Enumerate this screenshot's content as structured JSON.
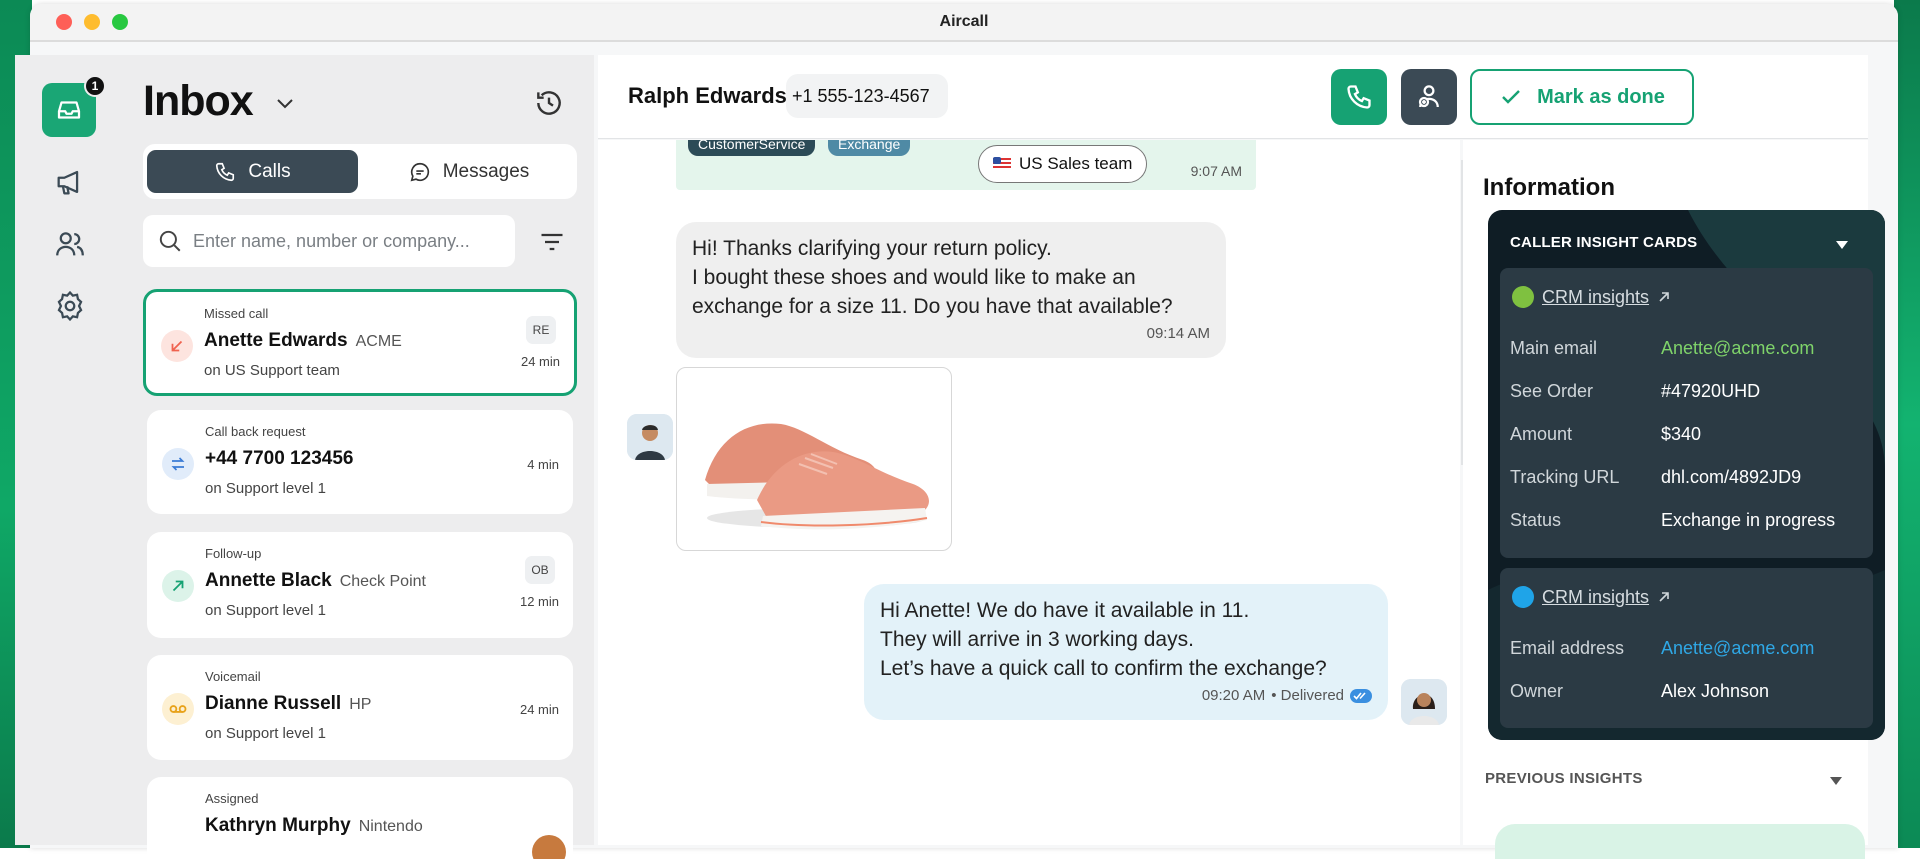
{
  "app": {
    "title": "Aircall"
  },
  "rail": {
    "badge": "1"
  },
  "inbox": {
    "title": "Inbox",
    "tabs": [
      {
        "label": "Calls"
      },
      {
        "label": "Messages"
      }
    ],
    "search_placeholder": "Enter name, number or company...",
    "items": [
      {
        "kind": "Missed call",
        "name": "Anette Edwards",
        "company": "ACME",
        "sub": "on  US Support team",
        "time": "24 min",
        "initials": "RE",
        "icon": "missed-call-icon",
        "color": "#f0624f"
      },
      {
        "kind": "Call back request",
        "name": "+44 7700 123456",
        "company": "",
        "sub": "on  Support level 1",
        "time": "4 min",
        "initials": "",
        "icon": "callback-icon",
        "color": "#3a7bd5"
      },
      {
        "kind": "Follow-up",
        "name": "Annette Black",
        "company": "Check Point",
        "sub": "on  Support level 1",
        "time": "12 min",
        "initials": "OB",
        "icon": "outgoing-call-icon",
        "color": "#16a273"
      },
      {
        "kind": "Voicemail",
        "name": "Dianne Russell",
        "company": "HP",
        "sub": "on  Support level 1",
        "time": "24 min",
        "initials": "",
        "icon": "voicemail-icon",
        "color": "#e8a21a"
      },
      {
        "kind": "Assigned",
        "name": "Kathryn Murphy",
        "company": "Nintendo",
        "sub": "",
        "time": "",
        "initials": "",
        "icon": "assigned-icon",
        "color": "#16a273"
      }
    ]
  },
  "conversation": {
    "contact_name": "Ralph Edwards",
    "phone": "+1 555-123-4567",
    "mark_done_label": "Mark as done",
    "tags": [
      "CustomerService",
      "Exchange"
    ],
    "team": "US Sales team",
    "tag_time": "9:07 AM",
    "incoming": {
      "lines": [
        "Hi! Thanks clarifying your return policy.",
        "I bought these shoes and would like to make an",
        "exchange for a size 11. Do you have that available?"
      ],
      "time": "09:14 AM"
    },
    "outgoing": {
      "lines": [
        "Hi Anette! We do have it available in 11.",
        "They will arrive in 3 working days.",
        "Let’s have a quick call to confirm the exchange?"
      ],
      "time": "09:20 AM",
      "status": "• Delivered"
    }
  },
  "information": {
    "title": "Information",
    "insight_header": "CALLER INSIGHT CARDS",
    "cards": [
      {
        "title": "CRM insights",
        "dot_color": "#7fc140",
        "rows": [
          {
            "key": "Main email",
            "value": "Anette@acme.com",
            "style": "green"
          },
          {
            "key": "See Order",
            "value": "#47920UHD",
            "style": ""
          },
          {
            "key": "Amount",
            "value": "$340",
            "style": ""
          },
          {
            "key": "Tracking URL",
            "value": "dhl.com/4892JD9",
            "style": ""
          },
          {
            "key": "Status",
            "value": "Exchange in progress",
            "style": ""
          }
        ]
      },
      {
        "title": "CRM insights",
        "dot_color": "#1fa4e8",
        "rows": [
          {
            "key": "Email address",
            "value": "Anette@acme.com",
            "style": "blue"
          },
          {
            "key": "Owner",
            "value": "Alex Johnson",
            "style": ""
          }
        ]
      }
    ],
    "previous_label": "PREVIOUS  INSIGHTS"
  }
}
